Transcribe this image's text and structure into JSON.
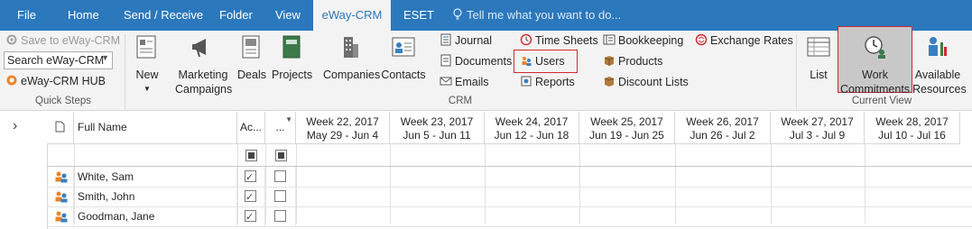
{
  "tabs": [
    {
      "label": "File",
      "active": false
    },
    {
      "label": "Home",
      "active": false
    },
    {
      "label": "Send / Receive",
      "active": false
    },
    {
      "label": "Folder",
      "active": false
    },
    {
      "label": "View",
      "active": false
    },
    {
      "label": "eWay-CRM",
      "active": true
    },
    {
      "label": "ESET",
      "active": false
    }
  ],
  "tell_me": "Tell me what you want to do...",
  "quick_steps": {
    "save_label": "Save to eWay-CRM",
    "search_value": "Search eWay-CRM",
    "hub_label": "eWay-CRM HUB",
    "group_label": "Quick Steps"
  },
  "crm": {
    "new_label": "New",
    "marketing_line1": "Marketing",
    "marketing_line2": "Campaigns",
    "deals_label": "Deals",
    "projects_label": "Projects",
    "companies_label": "Companies",
    "contacts_label": "Contacts",
    "journal_label": "Journal",
    "documents_label": "Documents",
    "emails_label": "Emails",
    "timesheets_label": "Time Sheets",
    "users_label": "Users",
    "reports_label": "Reports",
    "bookkeeping_label": "Bookkeeping",
    "products_label": "Products",
    "discount_label": "Discount Lists",
    "exchange_label": "Exchange Rates",
    "group_label": "CRM"
  },
  "current_view": {
    "list_label": "List",
    "work_line1": "Work",
    "work_line2": "Commitments",
    "available_line1": "Available",
    "available_line2": "Resources",
    "group_label": "Current View"
  },
  "grid": {
    "expand_glyph": "›",
    "fullname_header": "Full Name",
    "active_header": "Ac...",
    "other_header": "...",
    "weeks": [
      {
        "week": "Week 22, 2017",
        "range": "May 29 - Jun 4"
      },
      {
        "week": "Week 23, 2017",
        "range": "Jun 5 - Jun 11"
      },
      {
        "week": "Week 24, 2017",
        "range": "Jun 12 - Jun 18"
      },
      {
        "week": "Week 25, 2017",
        "range": "Jun 19 - Jun 25"
      },
      {
        "week": "Week 26, 2017",
        "range": "Jun 26 - Jul 2"
      },
      {
        "week": "Week 27, 2017",
        "range": "Jul 3 - Jul 9"
      },
      {
        "week": "Week 28, 2017",
        "range": "Jul 10 - Jul 16"
      }
    ],
    "rows": [
      {
        "name": "White, Sam",
        "active": true,
        "other": false
      },
      {
        "name": "Smith, John",
        "active": true,
        "other": false
      },
      {
        "name": "Goodman, Jane",
        "active": true,
        "other": false
      }
    ]
  },
  "colors": {
    "accent": "#2b78bd",
    "highlight": "#d3282c",
    "selected_bg": "#c8c8c8"
  }
}
